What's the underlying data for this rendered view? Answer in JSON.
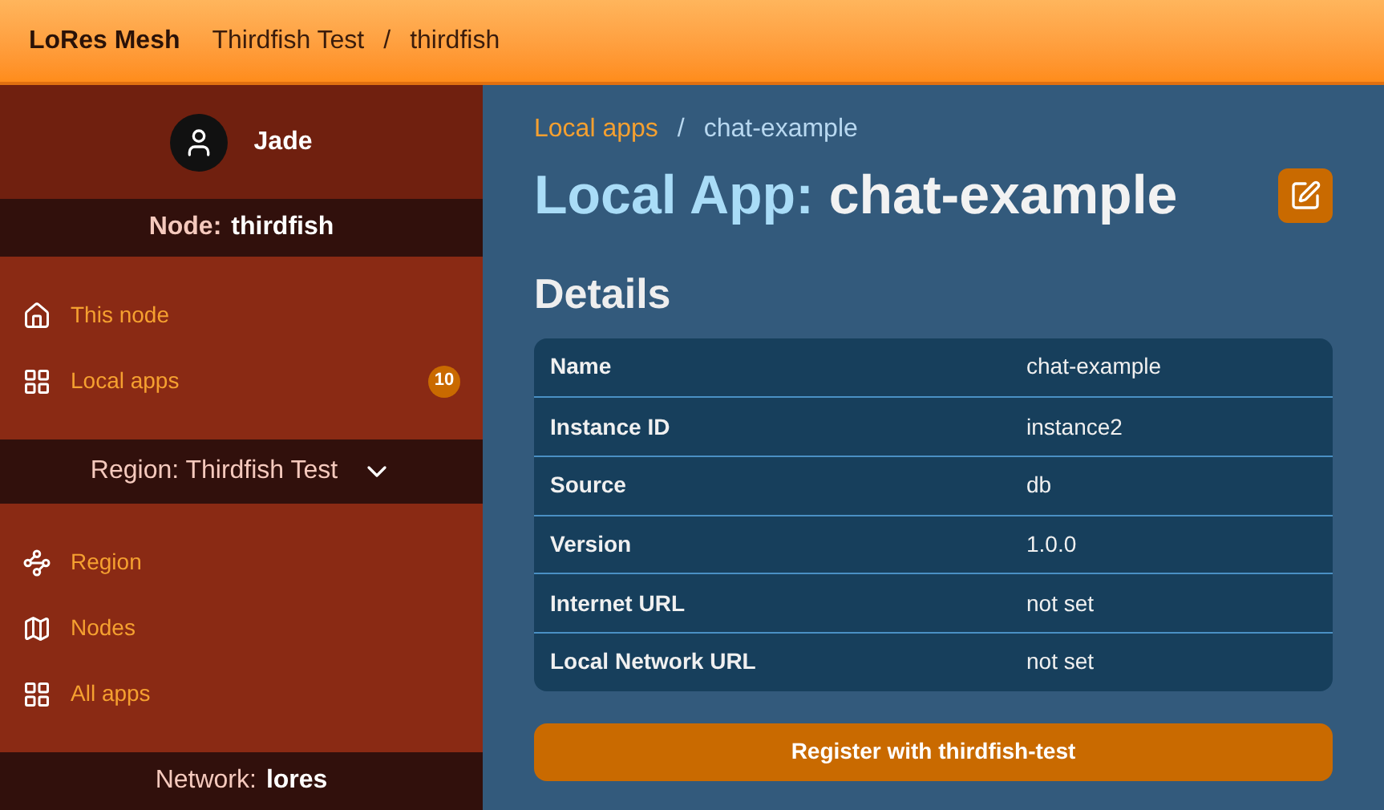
{
  "topbar": {
    "brand": "LoRes Mesh",
    "crumbs": [
      "Thirdfish Test",
      "/",
      "thirdfish"
    ]
  },
  "sidebar": {
    "user": {
      "name": "Jade"
    },
    "sections": [
      {
        "header": {
          "label": "Node:",
          "value": "thirdfish",
          "kind": "bold"
        },
        "items": [
          {
            "label": "This node",
            "kind": "home"
          },
          {
            "label": "Local apps",
            "kind": "apps",
            "badge": "10"
          }
        ]
      },
      {
        "header": {
          "label": "Region:",
          "value": "Thirdfish Test",
          "kind": "dropdown"
        },
        "items": [
          {
            "label": "Region",
            "kind": "graph"
          },
          {
            "label": "Nodes",
            "kind": "map"
          },
          {
            "label": "All apps",
            "kind": "apps"
          }
        ]
      },
      {
        "header": {
          "label": "Network:",
          "value": "lores",
          "kind": "mixed"
        }
      }
    ]
  },
  "main": {
    "breadcrumb": [
      "Local apps",
      "/",
      "chat-example"
    ],
    "title": {
      "prefix": "Local App:",
      "name": "chat-example"
    },
    "section_title": "Details",
    "details": [
      {
        "label": "Name",
        "value": "chat-example"
      },
      {
        "label": "Instance ID",
        "value": "instance2"
      },
      {
        "label": "Source",
        "value": "db"
      },
      {
        "label": "Version",
        "value": "1.0.0"
      },
      {
        "label": "Internet URL",
        "value": "not set"
      },
      {
        "label": "Local Network URL",
        "value": "not set"
      }
    ],
    "register_button": "Register with thirdfish-test"
  }
}
